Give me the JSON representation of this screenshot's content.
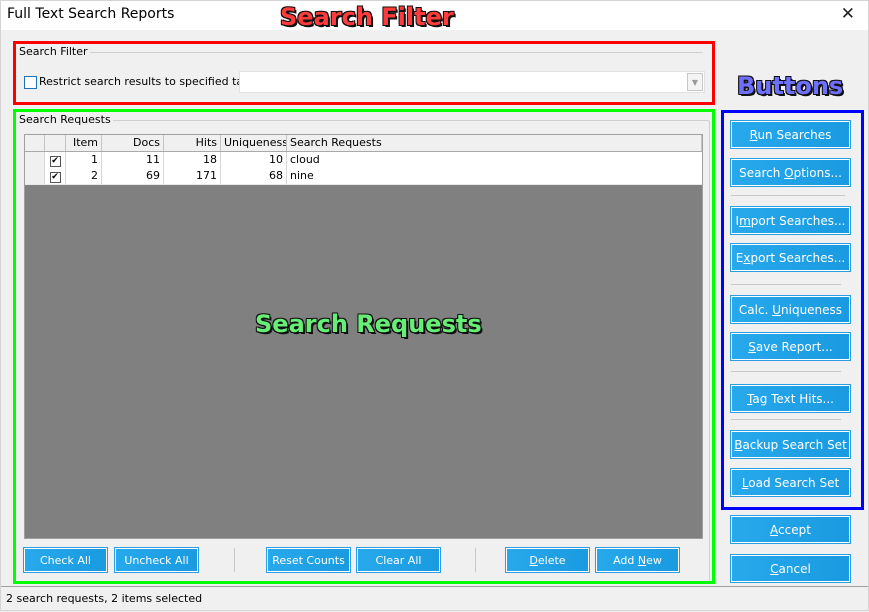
{
  "window": {
    "title": "Full Text Search Reports",
    "close_icon": "close-icon"
  },
  "annotations": {
    "search_filter": {
      "label": "Search Filter",
      "color": "#ff0000"
    },
    "buttons": {
      "label": "Buttons",
      "color": "#0000ff"
    },
    "search_requests": {
      "label": "Search Requests",
      "color": "#00ff00"
    }
  },
  "search_filter": {
    "group_title": "Search Filter",
    "restrict_checkbox": {
      "label": "Restrict search results to specified tag:",
      "checked": false
    },
    "tag_combo": {
      "value": ""
    }
  },
  "search_requests": {
    "group_title": "Search Requests",
    "columns": [
      "",
      "",
      "Item",
      "Docs",
      "Hits",
      "Uniqueness",
      "Search Requests"
    ],
    "rows": [
      {
        "checked": true,
        "item": "1",
        "docs": "11",
        "hits": "18",
        "uniqueness": "10",
        "request": "cloud"
      },
      {
        "checked": true,
        "item": "2",
        "docs": "69",
        "hits": "171",
        "uniqueness": "68",
        "request": "nine"
      }
    ],
    "check_mark": "✔",
    "buttons": {
      "check_all": "Check All",
      "uncheck_all": "Uncheck All",
      "reset_counts": "Reset Counts",
      "clear_all": "Clear All",
      "delete": "Delete",
      "add_new": "Add New"
    }
  },
  "side_buttons": {
    "run_searches": {
      "pre": "",
      "key": "R",
      "post": "un Searches"
    },
    "search_options": {
      "pre": "Search ",
      "key": "O",
      "post": "ptions..."
    },
    "import_searches": {
      "pre": "I",
      "key": "m",
      "post": "port Searches..."
    },
    "export_searches": {
      "pre": "E",
      "key": "x",
      "post": "port Searches..."
    },
    "calc_uniqueness": {
      "pre": "Calc. ",
      "key": "U",
      "post": "niqueness"
    },
    "save_report": {
      "pre": "",
      "key": "S",
      "post": "ave Report..."
    },
    "tag_text_hits": {
      "pre": "",
      "key": "T",
      "post": "ag Text Hits..."
    },
    "backup_search_set": {
      "pre": "",
      "key": "B",
      "post": "ackup Search Set"
    },
    "load_search_set": {
      "pre": "",
      "key": "L",
      "post": "oad Search Set"
    },
    "accept": {
      "pre": "",
      "key": "A",
      "post": "ccept"
    },
    "cancel": {
      "pre": "",
      "key": "C",
      "post": "ancel"
    }
  },
  "delete_key": {
    "key": "D",
    "post": "elete"
  },
  "add_new_key": {
    "pre": "Add ",
    "key": "N",
    "post": "ew"
  },
  "status": {
    "text": "2 search requests, 2 items selected"
  },
  "colors": {
    "button_blue": "#1ea1e6",
    "grid_empty": "#808080"
  }
}
